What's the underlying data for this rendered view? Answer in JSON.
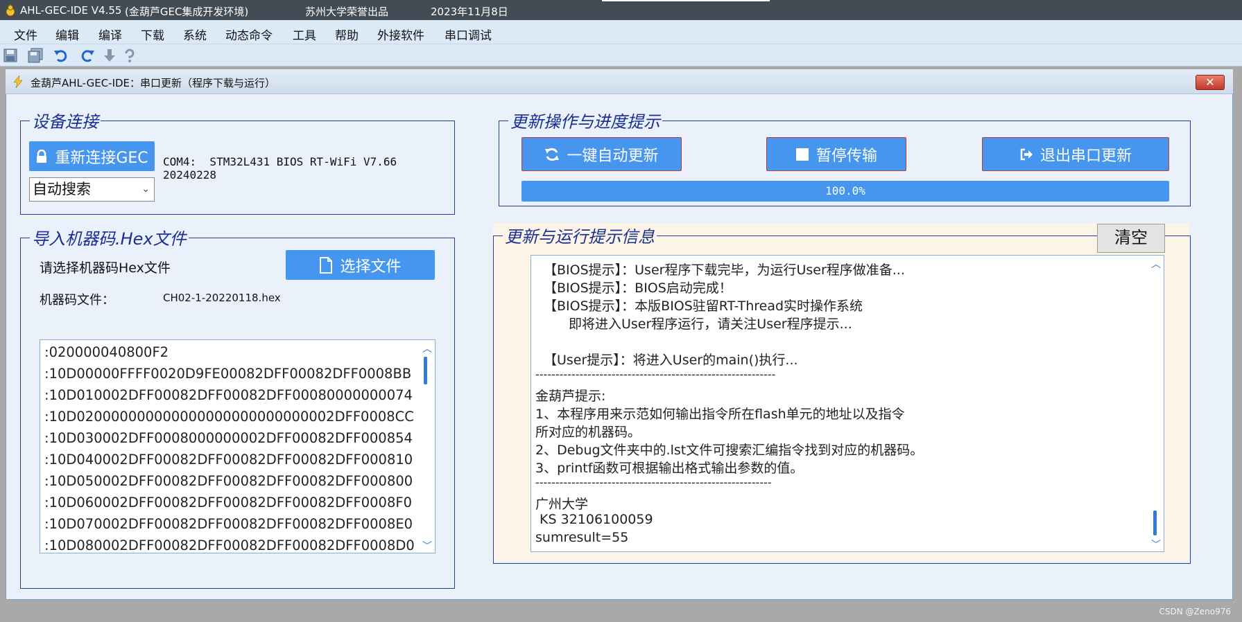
{
  "window": {
    "app_name": "AHL-GEC-IDE V4.55",
    "app_subtitle": "(金葫芦GEC集成开发环境)",
    "publisher": "苏州大学荣誉出品",
    "date": "2023年11月8日"
  },
  "menu": [
    "文件",
    "编辑",
    "编译",
    "下载",
    "系统",
    "动态命令",
    "工具",
    "帮助",
    "外接软件",
    "串口调试"
  ],
  "dialog": {
    "title": "金葫芦AHL-GEC-IDE：串口更新（程序下载与运行）",
    "close": "✕"
  },
  "device": {
    "legend": "设备连接",
    "reconnect_label": "重新连接GEC",
    "port_info_line1": "COM4:  STM32L431 BIOS RT-WiFi V7.66",
    "port_info_line2": "20240228",
    "search_mode": "自动搜索"
  },
  "update": {
    "legend": "更新操作与进度提示",
    "auto_update_label": "一键自动更新",
    "pause_label": "暂停传输",
    "exit_label": "退出串口更新",
    "progress_text": "100.0%",
    "progress_fraction": 1.0
  },
  "hex": {
    "legend": "导入机器码.Hex文件",
    "prompt": "请选择机器码Hex文件",
    "choose_label": "选择文件",
    "file_label": "机器码文件：",
    "file_name": "CH02-1-20220118.hex",
    "lines": [
      ":020000040800F2",
      ":10D00000FFFF0020D9FE00082DFF00082DFF0008BB",
      ":10D010002DFF00082DFF00082DFF00080000000074",
      ":10D020000000000000000000000000002DFF0008CC",
      ":10D030002DFF0008000000002DFF00082DFF000854",
      ":10D040002DFF00082DFF00082DFF00082DFF000810",
      ":10D050002DFF00082DFF00082DFF00082DFF000800",
      ":10D060002DFF00082DFF00082DFF00082DFF0008F0",
      ":10D070002DFF00082DFF00082DFF00082DFF0008E0",
      ":10D080002DFF00082DFF00082DFF00082DFF0008D0"
    ]
  },
  "log": {
    "legend": "更新与运行提示信息",
    "clear_label": "清空",
    "lines": [
      "【BIOS提示】：User程序下载完毕，为运行User程序做准备...",
      "【BIOS提示】：BIOS启动完成！",
      "【BIOS提示】：本版BIOS驻留RT-Thread实时操作系统",
      "即将进入User程序运行，请关注User程序提示...",
      "",
      "【User提示】：将进入User的main()执行...",
      "------------------------------------------------------------",
      "金葫芦提示:",
      "1、本程序用来示范如何输出指令所在flash单元的地址以及指令",
      "所对应的机器码。",
      "2、Debug文件夹中的.lst文件可搜索汇编指令找到对应的机器码。",
      "3、printf函数可根据输出格式输出参数的值。",
      "-----------------------------------------------------------",
      "广州大学",
      " KS 32106100059",
      "sumresult=55"
    ]
  },
  "watermark": "CSDN @Zeno976"
}
